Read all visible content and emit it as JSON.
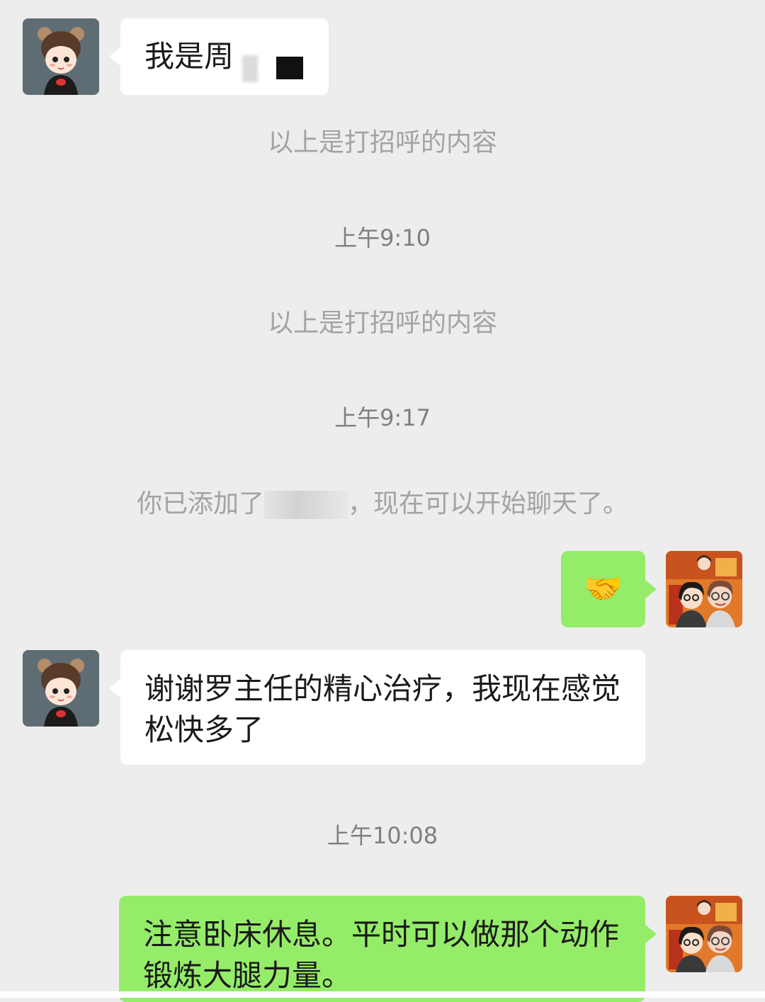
{
  "chat": {
    "msg1": {
      "text": "我是周",
      "sender": "contact",
      "avatar_icon": "cartoon-girl-avatar-icon"
    },
    "sys1": "以上是打招呼的内容",
    "time1": "上午9:10",
    "sys2": "以上是打招呼的内容",
    "time2": "上午9:17",
    "sys3_prefix": "你已添加了",
    "sys3_suffix": "，现在可以开始聊天了。",
    "msg2": {
      "emoji": "🤝",
      "emoji_icon": "handshake-icon",
      "sender": "me",
      "avatar_icon": "illustrated-couple-avatar-icon"
    },
    "msg3": {
      "text": "谢谢罗主任的精心治疗，我现在感觉松快多了",
      "sender": "contact"
    },
    "time3": "上午10:08",
    "msg4": {
      "text": "注意卧床休息。平时可以做那个动作锻炼大腿力量。",
      "sender": "me"
    }
  },
  "colors": {
    "background": "#ededed",
    "my_bubble": "#95ec69",
    "their_bubble": "#ffffff",
    "system_text": "#a3a3a3",
    "time_text": "#7f7f7f"
  }
}
